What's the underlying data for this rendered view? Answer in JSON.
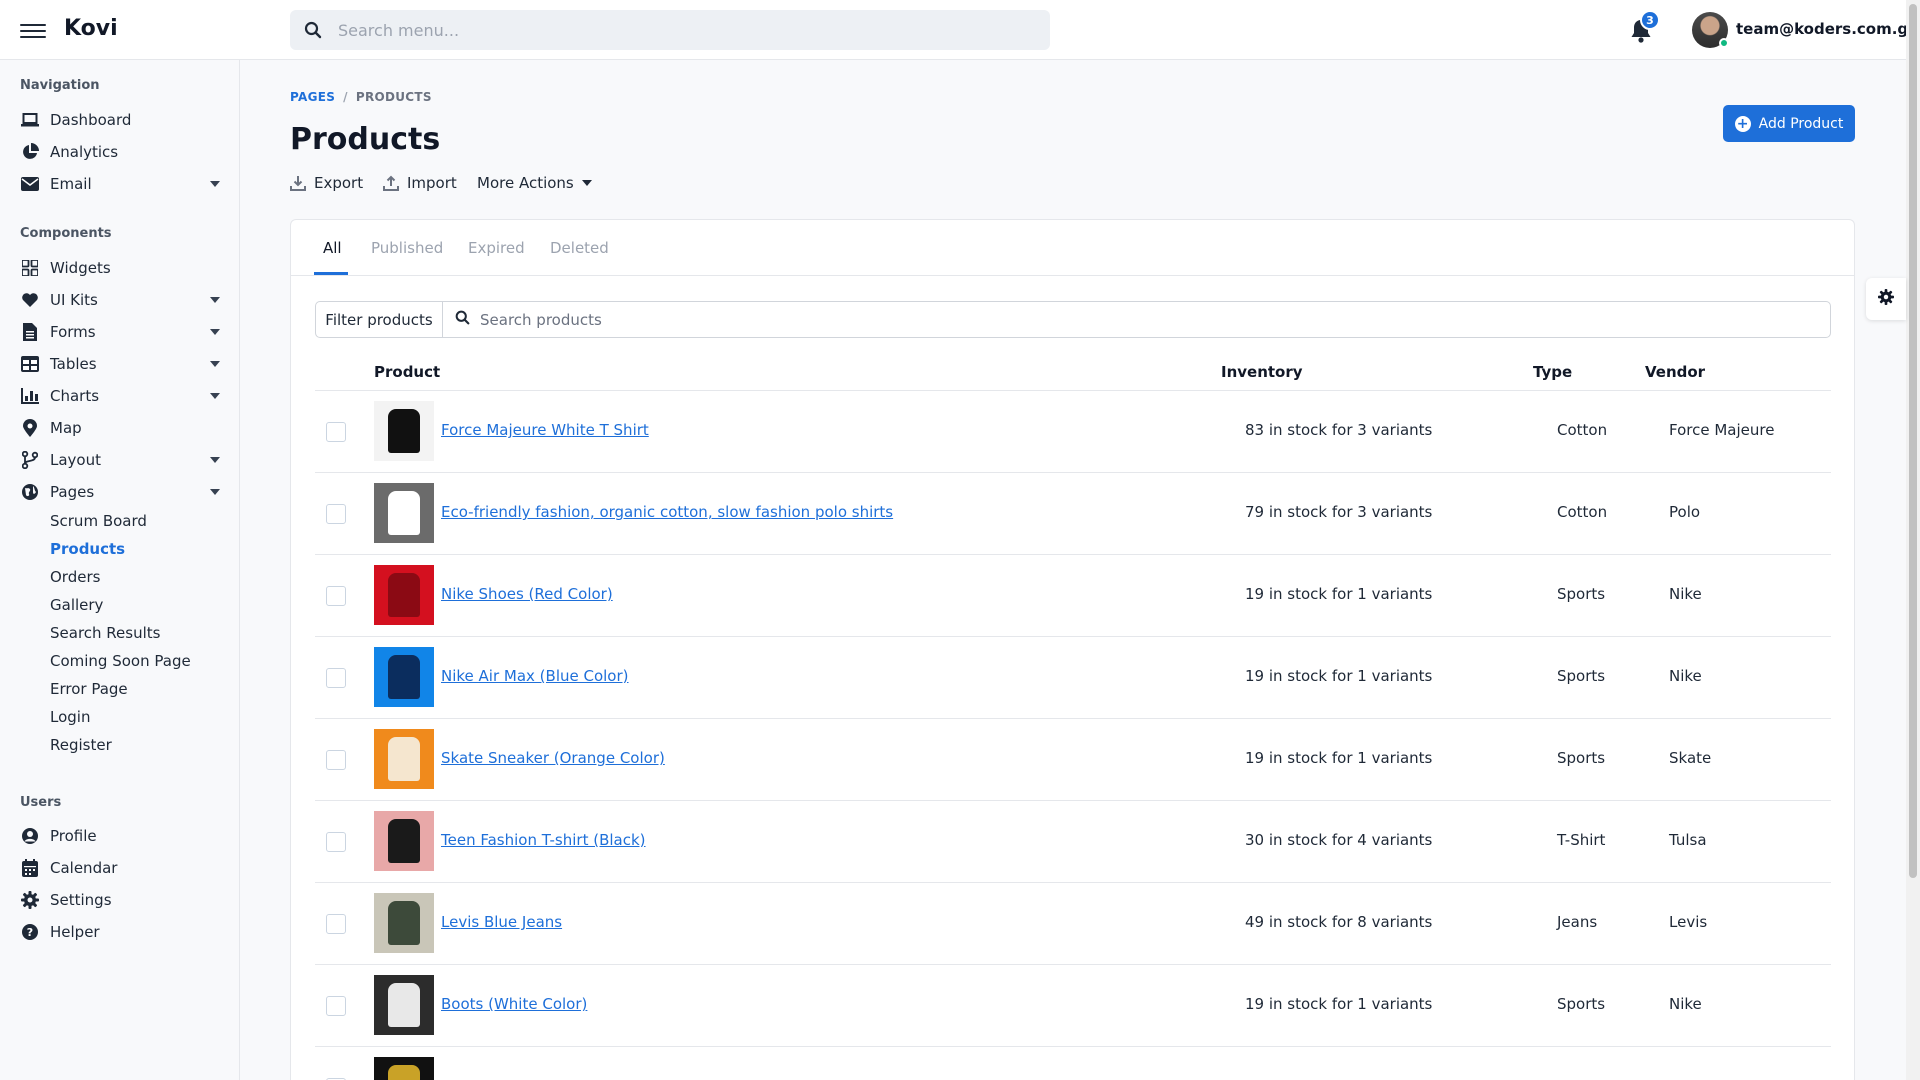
{
  "header": {
    "logo": "Kovi",
    "search_placeholder": "Search menu...",
    "notification_count": "3",
    "user_email": "team@koders.com.gt"
  },
  "sidebar": {
    "sections": {
      "navigation": "Navigation",
      "components": "Components",
      "users": "Users"
    },
    "navigation": [
      {
        "label": "Dashboard",
        "icon": "laptop-icon"
      },
      {
        "label": "Analytics",
        "icon": "pie-chart-icon"
      },
      {
        "label": "Email",
        "icon": "envelope-icon"
      }
    ],
    "components": [
      {
        "label": "Widgets",
        "icon": "grid-icon"
      },
      {
        "label": "UI Kits",
        "icon": "heart-icon"
      },
      {
        "label": "Forms",
        "icon": "file-icon"
      },
      {
        "label": "Tables",
        "icon": "table-icon"
      },
      {
        "label": "Charts",
        "icon": "chart-icon"
      },
      {
        "label": "Map",
        "icon": "map-pin-icon"
      },
      {
        "label": "Layout",
        "icon": "branch-icon"
      },
      {
        "label": "Pages",
        "icon": "globe-icon"
      }
    ],
    "pages_sub": [
      "Scrum Board",
      "Products",
      "Orders",
      "Gallery",
      "Search Results",
      "Coming Soon Page",
      "Error Page",
      "Login",
      "Register"
    ],
    "users": [
      {
        "label": "Profile",
        "icon": "user-circle-icon"
      },
      {
        "label": "Calendar",
        "icon": "calendar-icon"
      },
      {
        "label": "Settings",
        "icon": "gear-icon"
      },
      {
        "label": "Helper",
        "icon": "question-circle-icon"
      }
    ]
  },
  "main": {
    "breadcrumb": [
      "PAGES",
      "PRODUCTS"
    ],
    "title": "Products",
    "actions": {
      "export": "Export",
      "import": "Import",
      "more": "More Actions"
    },
    "add_button": "Add Product",
    "tabs": [
      "All",
      "Published",
      "Expired",
      "Deleted"
    ],
    "filter_button": "Filter products",
    "search_placeholder": "Search products",
    "columns": {
      "product": "Product",
      "inventory": "Inventory",
      "type": "Type",
      "vendor": "Vendor"
    },
    "products": [
      {
        "name": "Force Majeure White T Shirt",
        "inventory": "83 in stock for 3 variants",
        "type": "Cotton",
        "vendor": "Force Majeure",
        "thumb_color": "#111111",
        "thumb_bg": "#f3f3f3"
      },
      {
        "name": "Eco-friendly fashion, organic cotton, slow fashion polo shirts",
        "inventory": "79 in stock for 3 variants",
        "type": "Cotton",
        "vendor": "Polo",
        "thumb_color": "#ffffff",
        "thumb_bg": "#6b6b6b"
      },
      {
        "name": "Nike Shoes (Red Color)",
        "inventory": "19 in stock for 1 variants",
        "type": "Sports",
        "vendor": "Nike",
        "thumb_color": "#8b0a14",
        "thumb_bg": "#d4101f"
      },
      {
        "name": "Nike Air Max (Blue Color)",
        "inventory": "19 in stock for 1 variants",
        "type": "Sports",
        "vendor": "Nike",
        "thumb_color": "#0b2d5e",
        "thumb_bg": "#1185e8"
      },
      {
        "name": "Skate Sneaker (Orange Color)",
        "inventory": "19 in stock for 1 variants",
        "type": "Sports",
        "vendor": "Skate",
        "thumb_color": "#f5e6cf",
        "thumb_bg": "#f08a1c"
      },
      {
        "name": "Teen Fashion T-shirt (Black)",
        "inventory": "30 in stock for 4 variants",
        "type": "T-Shirt",
        "vendor": "Tulsa",
        "thumb_color": "#1a1a1a",
        "thumb_bg": "#e8a8a8"
      },
      {
        "name": "Levis Blue Jeans",
        "inventory": "49 in stock for 8 variants",
        "type": "Jeans",
        "vendor": "Levis",
        "thumb_color": "#3d4a3a",
        "thumb_bg": "#c9c6b8"
      },
      {
        "name": "Boots (White Color)",
        "inventory": "19 in stock for 1 variants",
        "type": "Sports",
        "vendor": "Nike",
        "thumb_color": "#e8e8e8",
        "thumb_bg": "#2c2c2c"
      },
      {
        "name": "",
        "inventory": "",
        "type": "",
        "vendor": "",
        "thumb_color": "#c9a227",
        "thumb_bg": "#111111"
      }
    ]
  },
  "colors": {
    "accent": "#1e6fd9",
    "badge": "#1e6fd9",
    "online": "#10b981"
  }
}
